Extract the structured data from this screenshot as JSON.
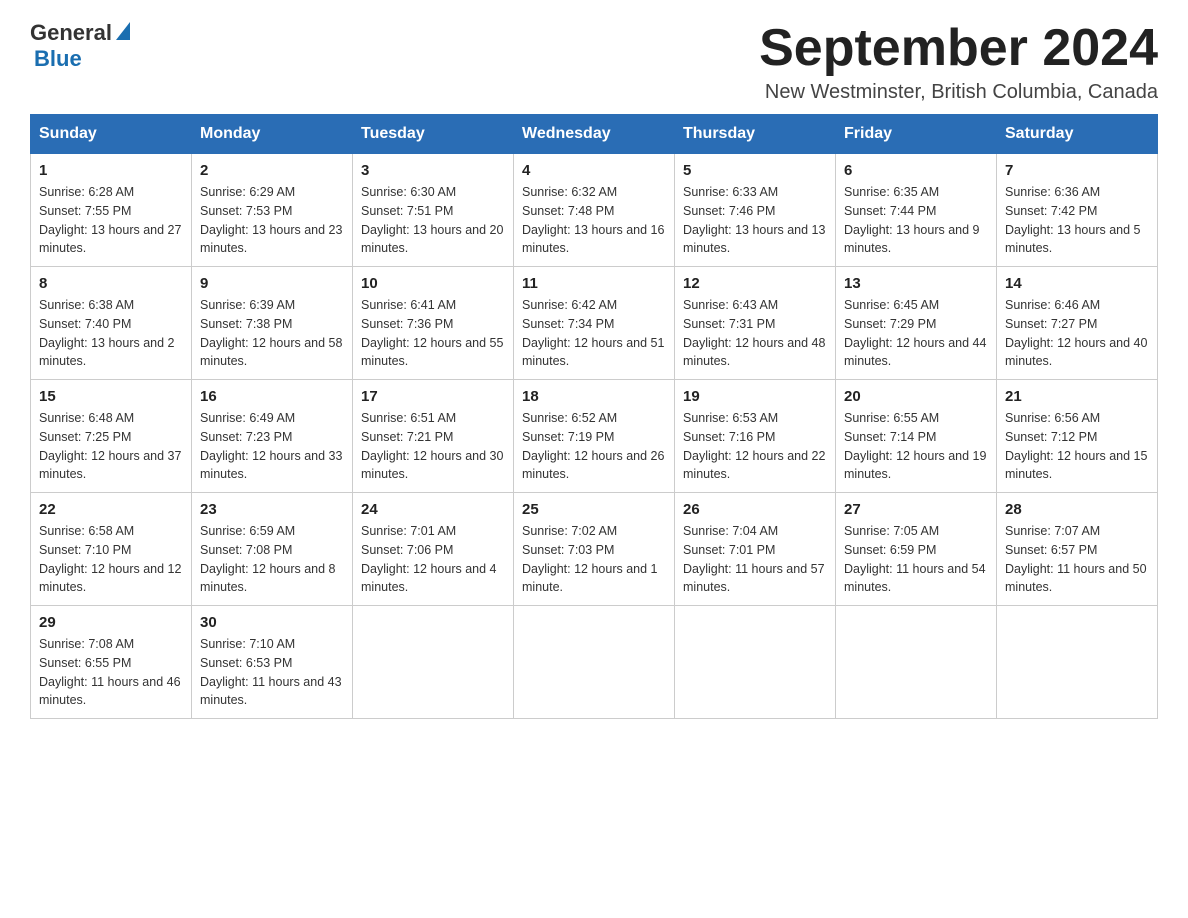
{
  "logo": {
    "general": "General",
    "blue": "Blue"
  },
  "header": {
    "month_year": "September 2024",
    "location": "New Westminster, British Columbia, Canada"
  },
  "weekdays": [
    "Sunday",
    "Monday",
    "Tuesday",
    "Wednesday",
    "Thursday",
    "Friday",
    "Saturday"
  ],
  "weeks": [
    [
      {
        "day": "1",
        "sunrise": "6:28 AM",
        "sunset": "7:55 PM",
        "daylight": "13 hours and 27 minutes."
      },
      {
        "day": "2",
        "sunrise": "6:29 AM",
        "sunset": "7:53 PM",
        "daylight": "13 hours and 23 minutes."
      },
      {
        "day": "3",
        "sunrise": "6:30 AM",
        "sunset": "7:51 PM",
        "daylight": "13 hours and 20 minutes."
      },
      {
        "day": "4",
        "sunrise": "6:32 AM",
        "sunset": "7:48 PM",
        "daylight": "13 hours and 16 minutes."
      },
      {
        "day": "5",
        "sunrise": "6:33 AM",
        "sunset": "7:46 PM",
        "daylight": "13 hours and 13 minutes."
      },
      {
        "day": "6",
        "sunrise": "6:35 AM",
        "sunset": "7:44 PM",
        "daylight": "13 hours and 9 minutes."
      },
      {
        "day": "7",
        "sunrise": "6:36 AM",
        "sunset": "7:42 PM",
        "daylight": "13 hours and 5 minutes."
      }
    ],
    [
      {
        "day": "8",
        "sunrise": "6:38 AM",
        "sunset": "7:40 PM",
        "daylight": "13 hours and 2 minutes."
      },
      {
        "day": "9",
        "sunrise": "6:39 AM",
        "sunset": "7:38 PM",
        "daylight": "12 hours and 58 minutes."
      },
      {
        "day": "10",
        "sunrise": "6:41 AM",
        "sunset": "7:36 PM",
        "daylight": "12 hours and 55 minutes."
      },
      {
        "day": "11",
        "sunrise": "6:42 AM",
        "sunset": "7:34 PM",
        "daylight": "12 hours and 51 minutes."
      },
      {
        "day": "12",
        "sunrise": "6:43 AM",
        "sunset": "7:31 PM",
        "daylight": "12 hours and 48 minutes."
      },
      {
        "day": "13",
        "sunrise": "6:45 AM",
        "sunset": "7:29 PM",
        "daylight": "12 hours and 44 minutes."
      },
      {
        "day": "14",
        "sunrise": "6:46 AM",
        "sunset": "7:27 PM",
        "daylight": "12 hours and 40 minutes."
      }
    ],
    [
      {
        "day": "15",
        "sunrise": "6:48 AM",
        "sunset": "7:25 PM",
        "daylight": "12 hours and 37 minutes."
      },
      {
        "day": "16",
        "sunrise": "6:49 AM",
        "sunset": "7:23 PM",
        "daylight": "12 hours and 33 minutes."
      },
      {
        "day": "17",
        "sunrise": "6:51 AM",
        "sunset": "7:21 PM",
        "daylight": "12 hours and 30 minutes."
      },
      {
        "day": "18",
        "sunrise": "6:52 AM",
        "sunset": "7:19 PM",
        "daylight": "12 hours and 26 minutes."
      },
      {
        "day": "19",
        "sunrise": "6:53 AM",
        "sunset": "7:16 PM",
        "daylight": "12 hours and 22 minutes."
      },
      {
        "day": "20",
        "sunrise": "6:55 AM",
        "sunset": "7:14 PM",
        "daylight": "12 hours and 19 minutes."
      },
      {
        "day": "21",
        "sunrise": "6:56 AM",
        "sunset": "7:12 PM",
        "daylight": "12 hours and 15 minutes."
      }
    ],
    [
      {
        "day": "22",
        "sunrise": "6:58 AM",
        "sunset": "7:10 PM",
        "daylight": "12 hours and 12 minutes."
      },
      {
        "day": "23",
        "sunrise": "6:59 AM",
        "sunset": "7:08 PM",
        "daylight": "12 hours and 8 minutes."
      },
      {
        "day": "24",
        "sunrise": "7:01 AM",
        "sunset": "7:06 PM",
        "daylight": "12 hours and 4 minutes."
      },
      {
        "day": "25",
        "sunrise": "7:02 AM",
        "sunset": "7:03 PM",
        "daylight": "12 hours and 1 minute."
      },
      {
        "day": "26",
        "sunrise": "7:04 AM",
        "sunset": "7:01 PM",
        "daylight": "11 hours and 57 minutes."
      },
      {
        "day": "27",
        "sunrise": "7:05 AM",
        "sunset": "6:59 PM",
        "daylight": "11 hours and 54 minutes."
      },
      {
        "day": "28",
        "sunrise": "7:07 AM",
        "sunset": "6:57 PM",
        "daylight": "11 hours and 50 minutes."
      }
    ],
    [
      {
        "day": "29",
        "sunrise": "7:08 AM",
        "sunset": "6:55 PM",
        "daylight": "11 hours and 46 minutes."
      },
      {
        "day": "30",
        "sunrise": "7:10 AM",
        "sunset": "6:53 PM",
        "daylight": "11 hours and 43 minutes."
      },
      null,
      null,
      null,
      null,
      null
    ]
  ]
}
